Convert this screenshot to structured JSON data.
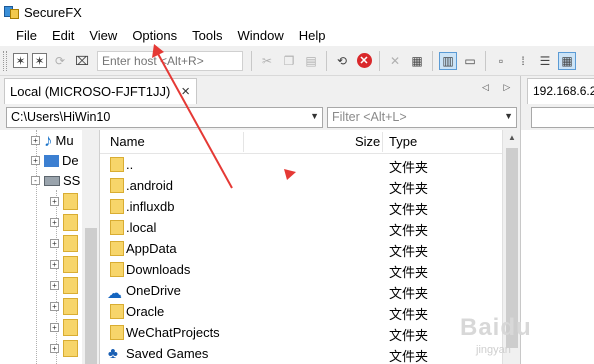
{
  "window": {
    "title": "SecureFX"
  },
  "menu": [
    "File",
    "Edit",
    "View",
    "Options",
    "Tools",
    "Window",
    "Help"
  ],
  "toolbar": {
    "host_placeholder": "Enter host <Alt+R>"
  },
  "tabs": {
    "local_label": "Local (MICROSO-FJFT1JJ)",
    "close_glyph": "×",
    "nav_glyphs": "◁ ▷",
    "remote_label": "192.168.6.2"
  },
  "local_pane": {
    "path_value": "C:\\Users\\HiWin10",
    "filter_placeholder": "Filter <Alt+L>"
  },
  "tree": {
    "items": [
      {
        "label": "Mu",
        "icon": "music-icon",
        "expander": "+"
      },
      {
        "label": "De",
        "icon": "desktop-icon",
        "expander": "+"
      },
      {
        "label": "SS",
        "icon": "drive-icon",
        "expander": "-"
      }
    ]
  },
  "file_list": {
    "columns": {
      "name": "Name",
      "size": "Size",
      "type": "Type"
    },
    "rows": [
      {
        "name": "..",
        "type": "文件夹",
        "icon": "folder-icon"
      },
      {
        "name": ".android",
        "type": "文件夹",
        "icon": "folder-icon"
      },
      {
        "name": ".influxdb",
        "type": "文件夹",
        "icon": "folder-icon"
      },
      {
        "name": ".local",
        "type": "文件夹",
        "icon": "folder-icon"
      },
      {
        "name": "AppData",
        "type": "文件夹",
        "icon": "folder-icon"
      },
      {
        "name": "Downloads",
        "type": "文件夹",
        "icon": "folder-icon"
      },
      {
        "name": "OneDrive",
        "type": "文件夹",
        "icon": "onedrive-icon"
      },
      {
        "name": "Oracle",
        "type": "文件夹",
        "icon": "folder-icon"
      },
      {
        "name": "WeChatProjects",
        "type": "文件夹",
        "icon": "folder-icon"
      },
      {
        "name": "Saved Games",
        "type": "文件夹",
        "icon": "saved-games-icon"
      }
    ]
  },
  "watermark": {
    "text": "Baidu",
    "sub": "jingyan"
  },
  "colors": {
    "annotation_arrow": "#e53935",
    "folder": "#f7d56a",
    "selection": "#cce4f7"
  }
}
